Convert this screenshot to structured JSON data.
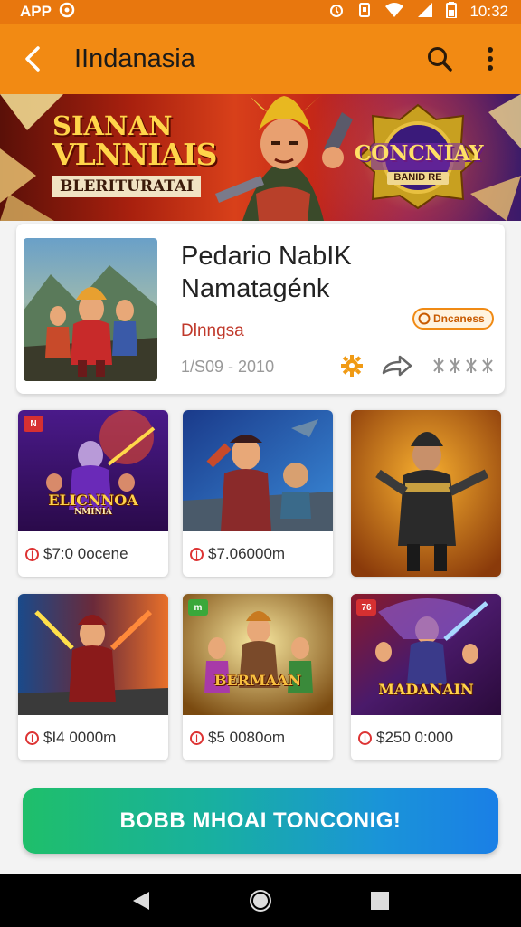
{
  "status_bar": {
    "carrier": "APP",
    "time": "10:32"
  },
  "app_bar": {
    "title": "IIndanasia",
    "back_icon": "chevron-left-icon",
    "search_icon": "search-icon",
    "menu_icon": "more-vert-icon"
  },
  "banner": {
    "line1": "SIANAN",
    "line2": "VLNNIAIS",
    "line3": "BLERITURATAI",
    "emblem_title": "CONCNIAY",
    "emblem_sub": "BANID RE"
  },
  "featured": {
    "title_line1": "Pedario NabIK",
    "title_line2": "Namatagénk",
    "subtitle": "Dlnngsa",
    "badge": "Dncaness",
    "date": "1/S09 - 2010",
    "actions": [
      "settings-icon",
      "share-icon",
      "more-icon"
    ]
  },
  "products": [
    {
      "title": "ELICNNOA",
      "subtitle": "NMINIA",
      "price": "$7:0 0ocene",
      "tag": "N",
      "tag_color": "#d63031",
      "colors": [
        "#3a1a6a",
        "#7a2ab8"
      ]
    },
    {
      "title": "",
      "subtitle": "",
      "price": "$7.06000m",
      "tag": "",
      "tag_color": "",
      "colors": [
        "#1a3a7a",
        "#c84a3a"
      ]
    },
    {
      "title": "",
      "subtitle": "",
      "price": "",
      "tag": "",
      "tag_color": "#3aa83a",
      "colors": [
        "#3a2a1a",
        "#e88a20"
      ]
    },
    {
      "title": "",
      "subtitle": "",
      "price": "$I4 0000m",
      "tag": "",
      "tag_color": "",
      "colors": [
        "#1a3a6a",
        "#b82a2a"
      ]
    },
    {
      "title": "BERMAAN",
      "subtitle": "",
      "price": "$5 0080om",
      "tag": "m",
      "tag_color": "#3aa83a",
      "colors": [
        "#6a3a10",
        "#e8a848"
      ]
    },
    {
      "title": "MADANAIN",
      "subtitle": "",
      "price": "$250 0:000",
      "tag": "76",
      "tag_color": "#d63031",
      "colors": [
        "#3a1a5a",
        "#c83a5a"
      ]
    }
  ],
  "cta": {
    "label": "BOBB MHOAI TONCONIG!"
  },
  "nav_bar": [
    "back-triangle-icon",
    "home-circle-icon",
    "recents-square-icon"
  ]
}
